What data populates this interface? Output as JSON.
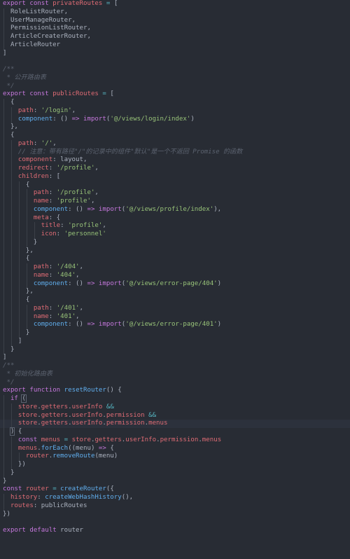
{
  "editor": {
    "theme_colors": {
      "background": "#282c34",
      "keyword": "#c678dd",
      "function": "#61afef",
      "property": "#e06c75",
      "string": "#98c379",
      "comment": "#5c6370",
      "operator": "#56b6c2",
      "plain": "#abb2bf"
    },
    "lines": [
      [
        [
          "kw",
          "export"
        ],
        [
          "p",
          " "
        ],
        [
          "kw",
          "const"
        ],
        [
          "p",
          " "
        ],
        [
          "prop",
          "privateRoutes"
        ],
        [
          "p",
          " "
        ],
        [
          "op",
          "="
        ],
        [
          "p",
          " ["
        ]
      ],
      [
        [
          "p",
          "  RoleListRouter,"
        ]
      ],
      [
        [
          "p",
          "  UserManageRouter,"
        ]
      ],
      [
        [
          "p",
          "  PermissionListRouter,"
        ]
      ],
      [
        [
          "p",
          "  ArticleCreaterRouter,"
        ]
      ],
      [
        [
          "p",
          "  ArticleRouter"
        ]
      ],
      [
        [
          "p",
          "]"
        ]
      ],
      [
        [
          "p",
          ""
        ]
      ],
      [
        [
          "cm",
          "/**"
        ]
      ],
      [
        [
          "cm",
          " * 公开路由表"
        ]
      ],
      [
        [
          "cm",
          " */"
        ]
      ],
      [
        [
          "kw",
          "export"
        ],
        [
          "p",
          " "
        ],
        [
          "kw",
          "const"
        ],
        [
          "p",
          " "
        ],
        [
          "prop",
          "publicRoutes"
        ],
        [
          "p",
          " "
        ],
        [
          "op",
          "="
        ],
        [
          "p",
          " ["
        ]
      ],
      [
        [
          "p",
          "  {"
        ]
      ],
      [
        [
          "p",
          "    "
        ],
        [
          "prop",
          "path"
        ],
        [
          "p",
          ": "
        ],
        [
          "str",
          "'/login'"
        ],
        [
          "p",
          ","
        ]
      ],
      [
        [
          "p",
          "    "
        ],
        [
          "fn",
          "component"
        ],
        [
          "p",
          ": () "
        ],
        [
          "kw",
          "=>"
        ],
        [
          "p",
          " "
        ],
        [
          "kw",
          "import"
        ],
        [
          "p",
          "("
        ],
        [
          "str",
          "'@/views/login/index'"
        ],
        [
          "p",
          ")"
        ]
      ],
      [
        [
          "p",
          "  },"
        ]
      ],
      [
        [
          "p",
          "  {"
        ]
      ],
      [
        [
          "p",
          "    "
        ],
        [
          "prop",
          "path"
        ],
        [
          "p",
          ": "
        ],
        [
          "str",
          "'/'"
        ],
        [
          "p",
          ","
        ]
      ],
      [
        [
          "p",
          "    "
        ],
        [
          "cm",
          "// 注意：带有路径\"/\"的记录中的组件\"默认\"是一个不返回 Promise 的函数"
        ]
      ],
      [
        [
          "p",
          "    "
        ],
        [
          "prop",
          "component"
        ],
        [
          "p",
          ": layout,"
        ]
      ],
      [
        [
          "p",
          "    "
        ],
        [
          "prop",
          "redirect"
        ],
        [
          "p",
          ": "
        ],
        [
          "str",
          "'/profile'"
        ],
        [
          "p",
          ","
        ]
      ],
      [
        [
          "p",
          "    "
        ],
        [
          "prop",
          "children"
        ],
        [
          "p",
          ": ["
        ]
      ],
      [
        [
          "p",
          "      {"
        ]
      ],
      [
        [
          "p",
          "        "
        ],
        [
          "prop",
          "path"
        ],
        [
          "p",
          ": "
        ],
        [
          "str",
          "'/profile'"
        ],
        [
          "p",
          ","
        ]
      ],
      [
        [
          "p",
          "        "
        ],
        [
          "prop",
          "name"
        ],
        [
          "p",
          ": "
        ],
        [
          "str",
          "'profile'"
        ],
        [
          "p",
          ","
        ]
      ],
      [
        [
          "p",
          "        "
        ],
        [
          "fn",
          "component"
        ],
        [
          "p",
          ": () "
        ],
        [
          "kw",
          "=>"
        ],
        [
          "p",
          " "
        ],
        [
          "kw",
          "import"
        ],
        [
          "p",
          "("
        ],
        [
          "str",
          "'@/views/profile/index'"
        ],
        [
          "p",
          "),"
        ]
      ],
      [
        [
          "p",
          "        "
        ],
        [
          "prop",
          "meta"
        ],
        [
          "p",
          ": {"
        ]
      ],
      [
        [
          "p",
          "          "
        ],
        [
          "prop",
          "title"
        ],
        [
          "p",
          ": "
        ],
        [
          "str",
          "'profile'"
        ],
        [
          "p",
          ","
        ]
      ],
      [
        [
          "p",
          "          "
        ],
        [
          "prop",
          "icon"
        ],
        [
          "p",
          ": "
        ],
        [
          "str",
          "'personnel'"
        ]
      ],
      [
        [
          "p",
          "        }"
        ]
      ],
      [
        [
          "p",
          "      },"
        ]
      ],
      [
        [
          "p",
          "      {"
        ]
      ],
      [
        [
          "p",
          "        "
        ],
        [
          "prop",
          "path"
        ],
        [
          "p",
          ": "
        ],
        [
          "str",
          "'/404'"
        ],
        [
          "p",
          ","
        ]
      ],
      [
        [
          "p",
          "        "
        ],
        [
          "prop",
          "name"
        ],
        [
          "p",
          ": "
        ],
        [
          "str",
          "'404'"
        ],
        [
          "p",
          ","
        ]
      ],
      [
        [
          "p",
          "        "
        ],
        [
          "fn",
          "component"
        ],
        [
          "p",
          ": () "
        ],
        [
          "kw",
          "=>"
        ],
        [
          "p",
          " "
        ],
        [
          "kw",
          "import"
        ],
        [
          "p",
          "("
        ],
        [
          "str",
          "'@/views/error-page/404'"
        ],
        [
          "p",
          ")"
        ]
      ],
      [
        [
          "p",
          "      },"
        ]
      ],
      [
        [
          "p",
          "      {"
        ]
      ],
      [
        [
          "p",
          "        "
        ],
        [
          "prop",
          "path"
        ],
        [
          "p",
          ": "
        ],
        [
          "str",
          "'/401'"
        ],
        [
          "p",
          ","
        ]
      ],
      [
        [
          "p",
          "        "
        ],
        [
          "prop",
          "name"
        ],
        [
          "p",
          ": "
        ],
        [
          "str",
          "'401'"
        ],
        [
          "p",
          ","
        ]
      ],
      [
        [
          "p",
          "        "
        ],
        [
          "fn",
          "component"
        ],
        [
          "p",
          ": () "
        ],
        [
          "kw",
          "=>"
        ],
        [
          "p",
          " "
        ],
        [
          "kw",
          "import"
        ],
        [
          "p",
          "("
        ],
        [
          "str",
          "'@/views/error-page/401'"
        ],
        [
          "p",
          ")"
        ]
      ],
      [
        [
          "p",
          "      }"
        ]
      ],
      [
        [
          "p",
          "    ]"
        ]
      ],
      [
        [
          "p",
          "  }"
        ]
      ],
      [
        [
          "p",
          "]"
        ]
      ],
      [
        [
          "cm",
          "/**"
        ]
      ],
      [
        [
          "cm",
          " * 初始化路由表"
        ]
      ],
      [
        [
          "cm",
          " */"
        ]
      ],
      [
        [
          "kw",
          "export"
        ],
        [
          "p",
          " "
        ],
        [
          "kw",
          "function"
        ],
        [
          "p",
          " "
        ],
        [
          "fn",
          "resetRouter"
        ],
        [
          "p",
          "() {"
        ]
      ],
      [
        [
          "p",
          "  "
        ],
        [
          "kw",
          "if"
        ],
        [
          "p",
          " "
        ],
        [
          "br",
          "("
        ]
      ],
      [
        [
          "p",
          "    "
        ],
        [
          "prop",
          "store"
        ],
        [
          "p",
          "."
        ],
        [
          "prop",
          "getters"
        ],
        [
          "p",
          "."
        ],
        [
          "prop",
          "userInfo"
        ],
        [
          "p",
          " "
        ],
        [
          "op",
          "&&"
        ]
      ],
      [
        [
          "p",
          "    "
        ],
        [
          "prop",
          "store"
        ],
        [
          "p",
          "."
        ],
        [
          "prop",
          "getters"
        ],
        [
          "p",
          "."
        ],
        [
          "prop",
          "userInfo"
        ],
        [
          "p",
          "."
        ],
        [
          "prop",
          "permission"
        ],
        [
          "p",
          " "
        ],
        [
          "op",
          "&&"
        ]
      ],
      [
        [
          "p",
          "    "
        ],
        [
          "prop",
          "store"
        ],
        [
          "p",
          "."
        ],
        [
          "prop",
          "getters"
        ],
        [
          "p",
          "."
        ],
        [
          "prop",
          "userInfo"
        ],
        [
          "p",
          "."
        ],
        [
          "prop",
          "permission"
        ],
        [
          "p",
          "."
        ],
        [
          "prop",
          "menus"
        ]
      ],
      [
        [
          "p",
          "  "
        ],
        [
          "br",
          ")"
        ],
        [
          "p",
          " {"
        ]
      ],
      [
        [
          "p",
          "    "
        ],
        [
          "kw",
          "const"
        ],
        [
          "p",
          " "
        ],
        [
          "prop",
          "menus"
        ],
        [
          "p",
          " "
        ],
        [
          "op",
          "="
        ],
        [
          "p",
          " "
        ],
        [
          "prop",
          "store"
        ],
        [
          "p",
          "."
        ],
        [
          "prop",
          "getters"
        ],
        [
          "p",
          "."
        ],
        [
          "prop",
          "userInfo"
        ],
        [
          "p",
          "."
        ],
        [
          "prop",
          "permission"
        ],
        [
          "p",
          "."
        ],
        [
          "prop",
          "menus"
        ]
      ],
      [
        [
          "p",
          "    "
        ],
        [
          "prop",
          "menus"
        ],
        [
          "p",
          "."
        ],
        [
          "fn",
          "forEach"
        ],
        [
          "p",
          "((menu) "
        ],
        [
          "kw",
          "=>"
        ],
        [
          "p",
          " {"
        ]
      ],
      [
        [
          "p",
          "      "
        ],
        [
          "prop",
          "router"
        ],
        [
          "p",
          "."
        ],
        [
          "fn",
          "removeRoute"
        ],
        [
          "p",
          "(menu)"
        ]
      ],
      [
        [
          "p",
          "    })"
        ]
      ],
      [
        [
          "p",
          "  }"
        ]
      ],
      [
        [
          "p",
          "}"
        ]
      ],
      [
        [
          "kw",
          "const"
        ],
        [
          "p",
          " "
        ],
        [
          "prop",
          "router"
        ],
        [
          "p",
          " "
        ],
        [
          "op",
          "="
        ],
        [
          "p",
          " "
        ],
        [
          "fn",
          "createRouter"
        ],
        [
          "p",
          "({"
        ]
      ],
      [
        [
          "p",
          "  "
        ],
        [
          "prop",
          "history"
        ],
        [
          "p",
          ": "
        ],
        [
          "fn",
          "createWebHashHistory"
        ],
        [
          "p",
          "(),"
        ]
      ],
      [
        [
          "p",
          "  "
        ],
        [
          "prop",
          "routes"
        ],
        [
          "p",
          ": publicRoutes"
        ]
      ],
      [
        [
          "p",
          "})"
        ]
      ],
      [
        [
          "p",
          ""
        ]
      ],
      [
        [
          "kw",
          "export"
        ],
        [
          "p",
          " "
        ],
        [
          "kw",
          "default"
        ],
        [
          "p",
          " router"
        ]
      ]
    ],
    "highlighted_lines": [
      51
    ]
  }
}
